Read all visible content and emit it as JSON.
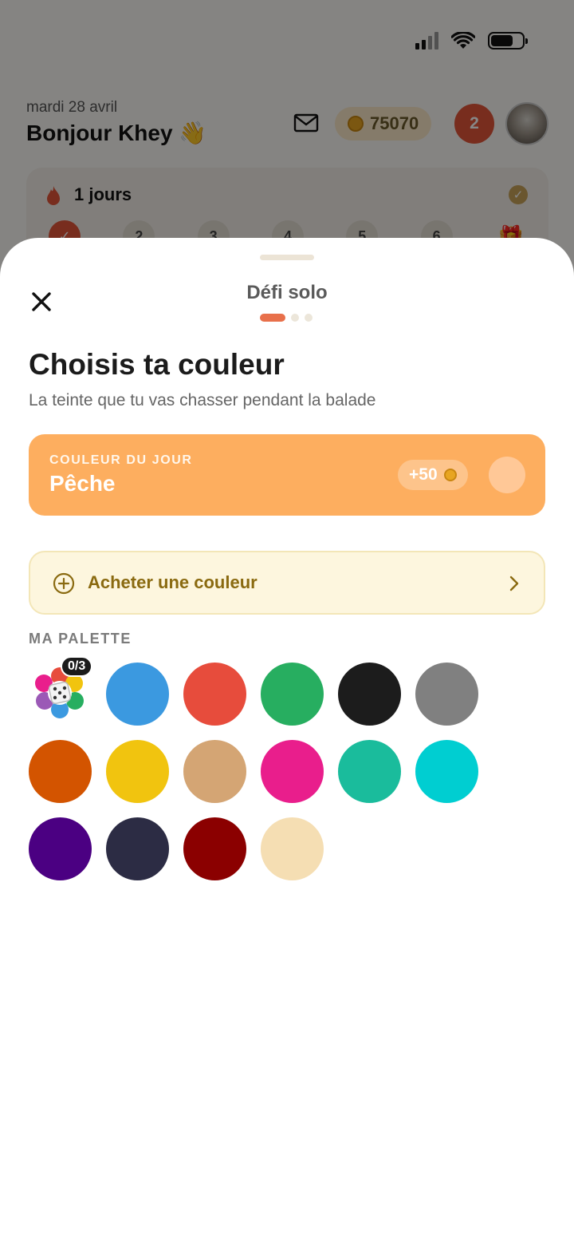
{
  "background": {
    "date": "mardi 28 avril",
    "greeting": "Bonjour Khey 👋",
    "coins": "75070",
    "notifications": "2",
    "streak": {
      "label": "1 jours",
      "days": [
        "✓",
        "2",
        "3",
        "4",
        "5",
        "6",
        "🎁"
      ]
    }
  },
  "sheet": {
    "title": "Défi solo",
    "heading": "Choisis ta couleur",
    "subheading": "La teinte que tu vas chasser pendant la balade",
    "daily": {
      "kicker": "COULEUR DU JOUR",
      "name": "Pêche",
      "reward": "+50",
      "color": "#ffc897"
    },
    "buy_label": "Acheter une couleur",
    "palette_label": "MA PALETTE",
    "random_badge": "0/3",
    "palette": [
      {
        "name": "bleu",
        "color": "#3b99e0"
      },
      {
        "name": "rouge",
        "color": "#e74c3c"
      },
      {
        "name": "vert",
        "color": "#27ae60"
      },
      {
        "name": "noir",
        "color": "#1c1c1c"
      },
      {
        "name": "gris",
        "color": "#808080"
      },
      {
        "name": "orange",
        "color": "#d35400"
      },
      {
        "name": "jaune",
        "color": "#f1c40f"
      },
      {
        "name": "beige",
        "color": "#d4a574"
      },
      {
        "name": "rose",
        "color": "#e91e8c"
      },
      {
        "name": "turquoise",
        "color": "#1abc9c"
      },
      {
        "name": "cyan",
        "color": "#00ced1"
      },
      {
        "name": "violet",
        "color": "#4b0082"
      },
      {
        "name": "marine",
        "color": "#2c2c44"
      },
      {
        "name": "bordeaux",
        "color": "#8b0000"
      },
      {
        "name": "crème",
        "color": "#f5deb3"
      }
    ]
  }
}
